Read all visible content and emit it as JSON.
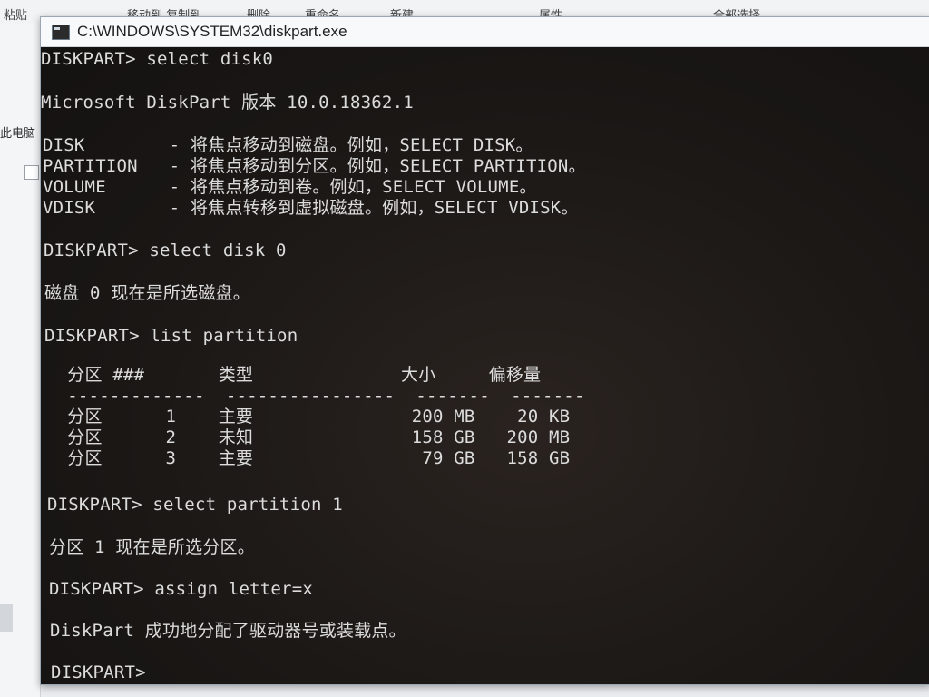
{
  "background": {
    "ribbon_items": [
      "粘贴",
      "移动到 复制到",
      "删除",
      "重命名",
      "新建",
      "属性",
      "全部选择"
    ],
    "left_label": "此电脑"
  },
  "window": {
    "title": "C:\\WINDOWS\\SYSTEM32\\diskpart.exe"
  },
  "console": {
    "lines": [
      "DISKPART> select disk0",
      "Microsoft DiskPart 版本 10.0.18362.1",
      "DISK        - 将焦点移动到磁盘。例如，SELECT DISK。",
      "PARTITION   - 将焦点移动到分区。例如，SELECT PARTITION。",
      "VOLUME      - 将焦点移动到卷。例如，SELECT VOLUME。",
      "VDISK       - 将焦点转移到虚拟磁盘。例如，SELECT VDISK。",
      "DISKPART> select disk 0",
      "磁盘 0 现在是所选磁盘。",
      "DISKPART> list partition",
      "  分区 ###       类型              大小     偏移量",
      "  -------------  ----------------  -------  -------",
      "  分区      1    主要               200 MB    20 KB",
      "  分区      2    未知               158 GB   200 MB",
      "  分区      3    主要                79 GB   158 GB",
      "DISKPART> select partition 1",
      "分区 1 现在是所选分区。",
      "DISKPART> assign letter=x",
      "DiskPart 成功地分配了驱动器号或装载点。",
      "DISKPART>"
    ]
  },
  "colors": {
    "console_bg": "#1b1816",
    "console_text": "#dcdcdc",
    "titlebar_bg": "#f8f9fa"
  }
}
